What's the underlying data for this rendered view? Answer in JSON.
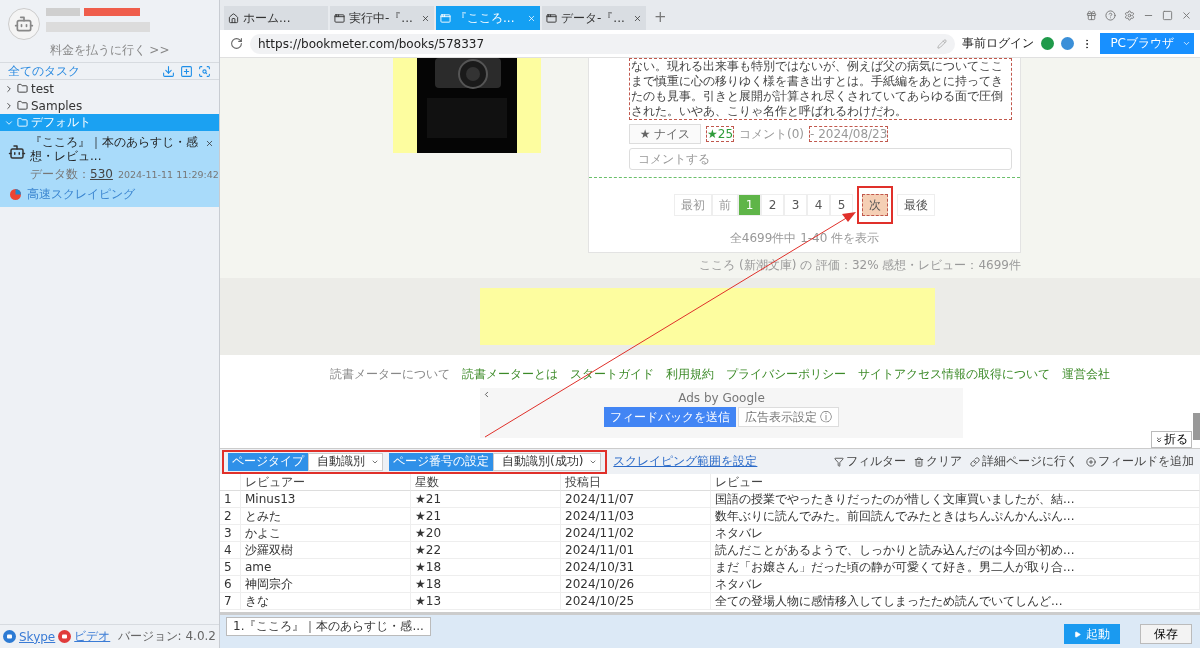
{
  "sidebar": {
    "pay_link": "料金を払うに行く >>",
    "header": "全てのタスク",
    "tree": [
      {
        "label": "test",
        "expanded": false,
        "selected": false
      },
      {
        "label": "Samples",
        "expanded": false,
        "selected": false
      },
      {
        "label": "デフォルト",
        "expanded": true,
        "selected": true,
        "tasks": [
          {
            "title": "『こころ』｜本のあらすじ・感想・レビュ...",
            "data_label": "データ数：",
            "data_count": "530",
            "date": "2024-11-11 11:29:42",
            "mode": "高速スクレイピング"
          }
        ]
      }
    ],
    "footer": {
      "links": [
        {
          "label": "Skype",
          "kind": "skype"
        },
        {
          "label": "ビデオ",
          "kind": "video"
        }
      ],
      "version": "バージョン: 4.0.2"
    }
  },
  "browser": {
    "tabs": [
      {
        "label": "ホーム...",
        "kind": "home",
        "selected": false
      },
      {
        "label": "実行中-『...",
        "kind": "page",
        "selected": false
      },
      {
        "label": "『こころ...",
        "kind": "page",
        "selected": true
      },
      {
        "label": "データ-『...",
        "kind": "page",
        "selected": false
      }
    ],
    "new_tab": "+",
    "url": "https://bookmeter.com/books/578337",
    "login": "事前ログイン",
    "mode_button": "PCブラウザ"
  },
  "page": {
    "review": {
      "text": "ない。現れる出来事も特別ではないが、例えば父の病気についてここまで慎重に心の移りゆく様を書き出すとは。手紙編をあとに持ってきたのも見事。引きと展開が計算され尽くされていてあらゆる面で圧倒された。いやあ、こりゃ名作と呼ばれるわけだわ。",
      "nice": "★ ナイス",
      "likes": "★25",
      "comments": "コメント(0)",
      "date": "- 2024/08/23",
      "comment_placeholder": "コメントする"
    },
    "pagination": [
      {
        "label": "最初",
        "selected": false,
        "disabled": true
      },
      {
        "label": "前",
        "selected": false,
        "disabled": true
      },
      {
        "label": "1",
        "selected": true,
        "disabled": false
      },
      {
        "label": "2",
        "selected": false,
        "disabled": false
      },
      {
        "label": "3",
        "selected": false,
        "disabled": false
      },
      {
        "label": "4",
        "selected": false,
        "disabled": false
      },
      {
        "label": "5",
        "selected": false,
        "disabled": false
      },
      {
        "label": "次",
        "selected": false,
        "disabled": false,
        "highlighted": true
      },
      {
        "label": "最後",
        "selected": false,
        "disabled": false
      }
    ],
    "summary": "全4699件中 1-40 件を表示",
    "book_info": "こころ (新潮文庫) の 評価：32% 感想・レビュー：4699件",
    "footer_links": [
      {
        "label": "読書メーターについて",
        "kind": "plain"
      },
      {
        "label": "読書メーターとは",
        "kind": "link"
      },
      {
        "label": "スタートガイド",
        "kind": "link"
      },
      {
        "label": "利用規約",
        "kind": "link"
      },
      {
        "label": "プライバシーポリシー",
        "kind": "link"
      },
      {
        "label": "サイトアクセス情報の取得について",
        "kind": "link"
      },
      {
        "label": "運営会社",
        "kind": "link"
      }
    ],
    "ad": {
      "caption": "Ads by Google",
      "feedback": "フィードバックを送信",
      "settings": "広告表示設定 ⓘ"
    },
    "fold": "折る"
  },
  "toolbar": {
    "selects": [
      {
        "label": "ページタイプ",
        "value": "自動識別"
      },
      {
        "label": "ページ番号の設定",
        "value": "自動識別(成功)"
      }
    ],
    "range_link": "スクレイピング範囲を設定",
    "actions": [
      {
        "label": "フィルター",
        "kind": "filter"
      },
      {
        "label": "クリア",
        "kind": "clear"
      },
      {
        "label": "詳細ページに行く",
        "kind": "link"
      },
      {
        "label": "フィールドを追加",
        "kind": "add"
      }
    ]
  },
  "table": {
    "columns": [
      "レビュアー",
      "星数",
      "投稿日",
      "レビュー"
    ],
    "rows": [
      {
        "n": "1",
        "cells": [
          "Minus13",
          "★21",
          "2024/11/07",
          "国語の授業でやったきりだったのが惜しく文庫買いましたが、結..."
        ]
      },
      {
        "n": "2",
        "cells": [
          "とみた",
          "★21",
          "2024/11/03",
          "数年ぶりに読んでみた。前回読んでみたときはちんぷんかんぷん..."
        ]
      },
      {
        "n": "3",
        "cells": [
          "かよこ",
          "★20",
          "2024/11/02",
          "ネタバレ"
        ]
      },
      {
        "n": "4",
        "cells": [
          "沙羅双樹",
          "★22",
          "2024/11/01",
          "読んだことがあるようで、しっかりと読み込んだのは今回が初め..."
        ]
      },
      {
        "n": "5",
        "cells": [
          "ame",
          "★18",
          "2024/10/31",
          "まだ「お嬢さん」だった頃の静が可愛くて好き。男二人が取り合..."
        ]
      },
      {
        "n": "6",
        "cells": [
          "神岡宗介",
          "★18",
          "2024/10/26",
          "ネタバレ"
        ]
      },
      {
        "n": "7",
        "cells": [
          "きな",
          "★13",
          "2024/10/25",
          "全ての登場人物に感情移入してしまったため読んでいてしんど..."
        ]
      }
    ]
  },
  "bottom": {
    "task_tab": "1.『こころ』｜本のあらすじ・感...",
    "start": "起動",
    "save": "保存"
  }
}
